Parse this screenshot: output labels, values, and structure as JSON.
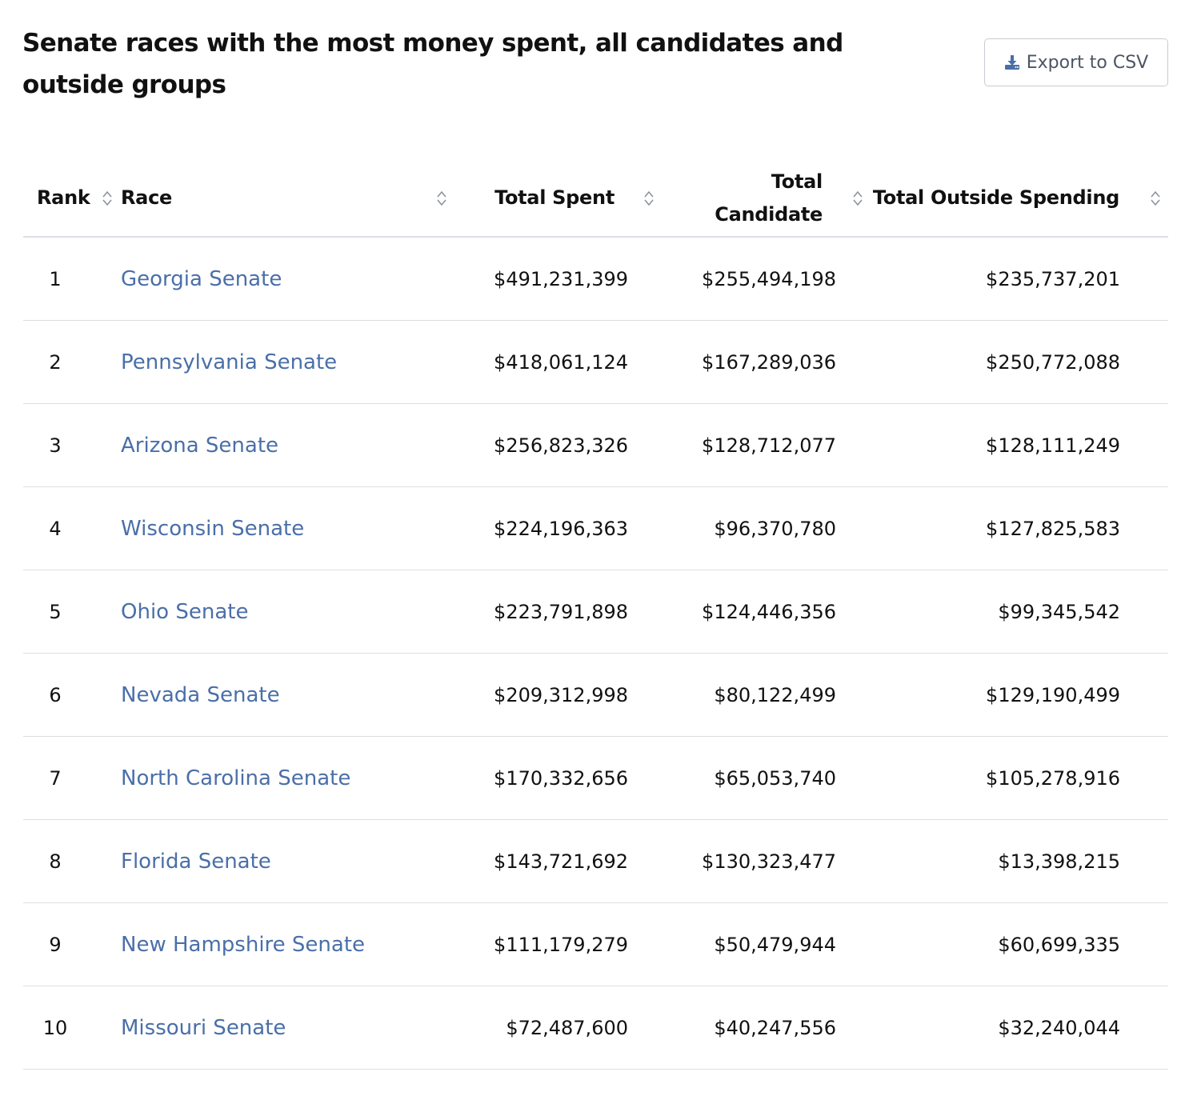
{
  "title": "Senate races with the most money spent, all candidates and outside groups",
  "export_label": "Export to CSV",
  "headers": {
    "rank": "Rank",
    "race": "Race",
    "total_spent": "Total Spent",
    "total_candidate_line1": "Total",
    "total_candidate_line2": "Candidate",
    "total_outside": "Total Outside Spending"
  },
  "rows": [
    {
      "rank": "1",
      "race": "Georgia Senate",
      "total_spent": "$491,231,399",
      "total_candidate": "$255,494,198",
      "total_outside": "$235,737,201"
    },
    {
      "rank": "2",
      "race": "Pennsylvania Senate",
      "total_spent": "$418,061,124",
      "total_candidate": "$167,289,036",
      "total_outside": "$250,772,088"
    },
    {
      "rank": "3",
      "race": "Arizona Senate",
      "total_spent": "$256,823,326",
      "total_candidate": "$128,712,077",
      "total_outside": "$128,111,249"
    },
    {
      "rank": "4",
      "race": "Wisconsin Senate",
      "total_spent": "$224,196,363",
      "total_candidate": "$96,370,780",
      "total_outside": "$127,825,583"
    },
    {
      "rank": "5",
      "race": "Ohio Senate",
      "total_spent": "$223,791,898",
      "total_candidate": "$124,446,356",
      "total_outside": "$99,345,542"
    },
    {
      "rank": "6",
      "race": "Nevada Senate",
      "total_spent": "$209,312,998",
      "total_candidate": "$80,122,499",
      "total_outside": "$129,190,499"
    },
    {
      "rank": "7",
      "race": "North Carolina Senate",
      "total_spent": "$170,332,656",
      "total_candidate": "$65,053,740",
      "total_outside": "$105,278,916"
    },
    {
      "rank": "8",
      "race": "Florida Senate",
      "total_spent": "$143,721,692",
      "total_candidate": "$130,323,477",
      "total_outside": "$13,398,215"
    },
    {
      "rank": "9",
      "race": "New Hampshire Senate",
      "total_spent": "$111,179,279",
      "total_candidate": "$50,479,944",
      "total_outside": "$60,699,335"
    },
    {
      "rank": "10",
      "race": "Missouri Senate",
      "total_spent": "$72,487,600",
      "total_candidate": "$40,247,556",
      "total_outside": "$32,240,044"
    }
  ],
  "icons": {
    "export": "download-icon",
    "sort": "sort-icon"
  },
  "colors": {
    "link": "#4a6fa8",
    "export_icon": "#4a6fa8",
    "border": "#dcdfe3",
    "text": "#111111"
  }
}
